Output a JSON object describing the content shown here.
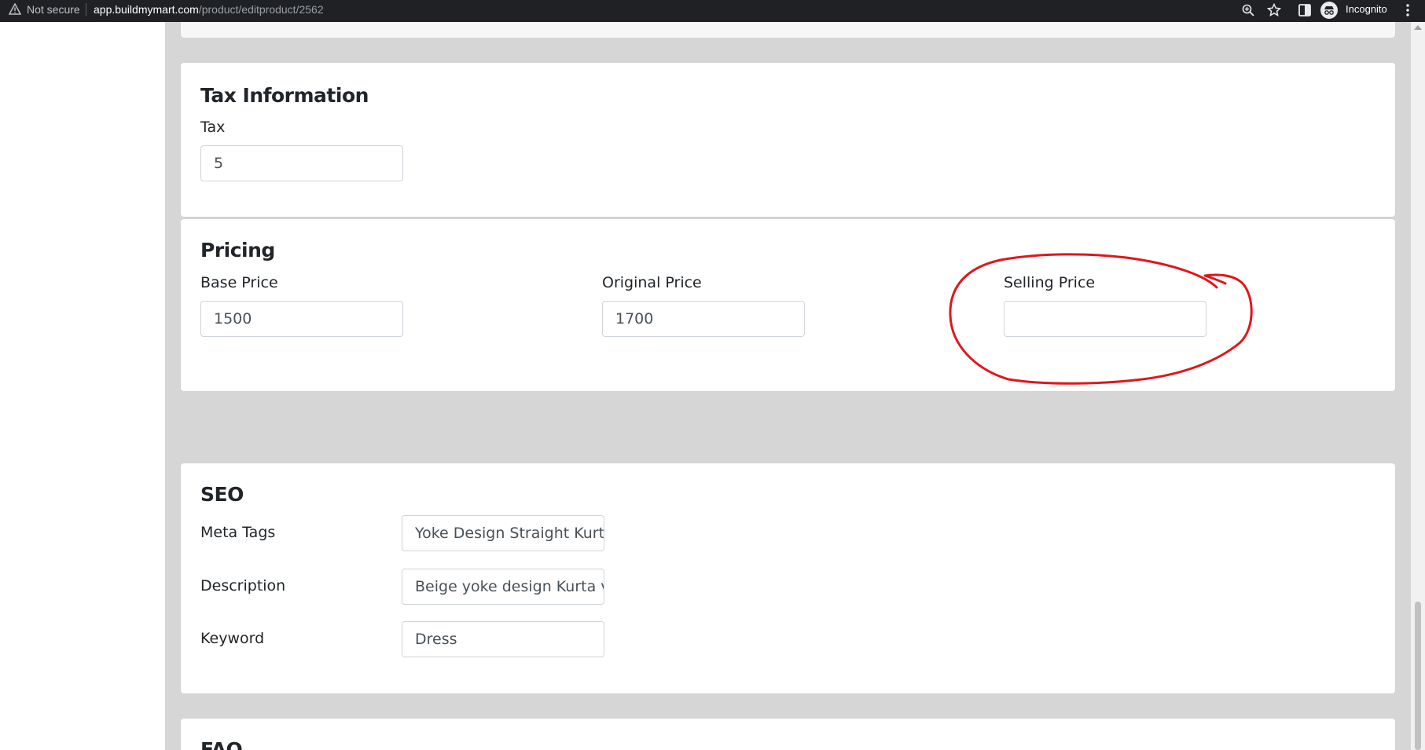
{
  "browser": {
    "security_label": "Not secure",
    "url_host": "app.buildmymart.com",
    "url_path": "/product/editproduct/2562",
    "incognito_label": "Incognito",
    "icons": [
      "warning-icon",
      "zoom-icon",
      "star-icon",
      "sidepanel-icon",
      "incognito-icon",
      "menu-icon"
    ]
  },
  "tax": {
    "title": "Tax Information",
    "tax_label": "Tax",
    "tax_value": "5"
  },
  "pricing": {
    "title": "Pricing",
    "base_label": "Base Price",
    "base_value": "1500",
    "original_label": "Original Price",
    "original_value": "1700",
    "selling_label": "Selling Price",
    "selling_value": ""
  },
  "seo": {
    "title": "SEO",
    "meta_label": "Meta Tags",
    "meta_value": "Yoke Design Straight Kurta",
    "description_label": "Description",
    "description_value": "Beige yoke design Kurta v",
    "keyword_label": "Keyword",
    "keyword_value": "Dress"
  },
  "faq": {
    "title": "FAQ"
  },
  "colors": {
    "annotation": "#e0161a",
    "page_bg": "#d6d6d6",
    "card_bg": "#ffffff"
  }
}
